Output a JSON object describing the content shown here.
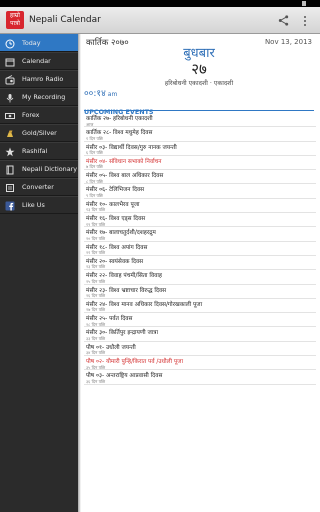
{
  "app": {
    "title": "Nepali Calendar",
    "logo_text_top": "हाम्रो",
    "logo_text_bottom": "पात्रो"
  },
  "drawer": {
    "items": [
      {
        "label": "Today",
        "icon": "calendar-today-icon",
        "active": true
      },
      {
        "label": "Calendar",
        "icon": "calendar-icon",
        "active": false
      },
      {
        "label": "Hamro Radio",
        "icon": "radio-icon",
        "active": false
      },
      {
        "label": "My Recording",
        "icon": "microphone-icon",
        "active": false
      },
      {
        "label": "Forex",
        "icon": "currency-icon",
        "active": false
      },
      {
        "label": "Gold/Silver",
        "icon": "gold-icon",
        "active": false
      },
      {
        "label": "Rashifal",
        "icon": "star-icon",
        "active": false
      },
      {
        "label": "Nepali Dictionary",
        "icon": "book-icon",
        "active": false
      },
      {
        "label": "Converter",
        "icon": "converter-icon",
        "active": false
      },
      {
        "label": "Like Us",
        "icon": "facebook-icon",
        "active": false
      }
    ]
  },
  "today": {
    "nepali_month": "कार्तिक २०७०",
    "english_date": "Nov 13, 2013",
    "weekday": "बुधबार",
    "day": "२७",
    "tithi": "हरिबोधनी एकादशी · एकादशी",
    "time": "००:१४",
    "ampm": "am"
  },
  "upcoming": {
    "header": "UPCOMING EVENTS",
    "events": [
      {
        "title": "कार्तिक २७- हरिबोधनी एकादशी",
        "sub": "आज",
        "holiday": false
      },
      {
        "title": "कार्तिक २८- विश्व मधुमेह दिवस",
        "sub": "१ दिन पछि",
        "holiday": false
      },
      {
        "title": "मंसीर ०३- विद्यार्थी दिवस/गुरु नानक जयन्ती",
        "sub": "६ दिन पछि",
        "holiday": false
      },
      {
        "title": "मंसीर ०४- संविधान सभाको निर्वाचन",
        "sub": "७ दिन पछि",
        "holiday": true
      },
      {
        "title": "मंसीर ०५- विश्व बाल अधिकार दिवस",
        "sub": "८ दिन पछि",
        "holiday": false
      },
      {
        "title": "मंसीर ०६- टेलिभिजन दिवस",
        "sub": "९ दिन पछि",
        "holiday": false
      },
      {
        "title": "मंसीर १०- कालभैरव पूजा",
        "sub": "१३ दिन पछि",
        "holiday": false
      },
      {
        "title": "मंसीर १६- विश्व एड्स दिवस",
        "sub": "१९ दिन पछि",
        "holiday": false
      },
      {
        "title": "मंसीर १७- बालाचतुर्दशी/दशहरद्रुम",
        "sub": "२० दिन पछि",
        "holiday": false
      },
      {
        "title": "मंसीर १८- विश्व अपांग दिवस",
        "sub": "२१ दिन पछि",
        "holiday": false
      },
      {
        "title": "मंसीर २०- स्वयंसेवक दिवस",
        "sub": "२३ दिन पछि",
        "holiday": false
      },
      {
        "title": "मंसीर २२- विवाह पंचमी/सिता विवाह",
        "sub": "२५ दिन पछि",
        "holiday": false
      },
      {
        "title": "मंसीर २३- विश्व भ्रष्टाचार विरुद्ध दिवस",
        "sub": "२६ दिन पछि",
        "holiday": false
      },
      {
        "title": "मंसीर २४- विश्व मानव अधिकार दिवस/गोरखकाली पूजा",
        "sub": "२७ दिन पछि",
        "holiday": false
      },
      {
        "title": "मंसीर २५- पर्वत दिवस",
        "sub": "२८ दिन पछि",
        "holiday": false
      },
      {
        "title": "मंसीर ३०- किर्तिपुर इन्द्रायणी जात्रा",
        "sub": "३३ दिन पछि",
        "holiday": false
      },
      {
        "title": "पौष ०१- उधौली जयन्ती",
        "sub": "३४ दिन पछि",
        "holiday": false
      },
      {
        "title": "पौष ०२- यौमारी पुन्हि/किरात पर्व /उधौली पूजा",
        "sub": "३५ दिन पछि",
        "holiday": true
      },
      {
        "title": "पौष ०३- अन्तराष्ट्रिय आप्रवासी दिवस",
        "sub": "३६ दिन पछि",
        "holiday": false
      }
    ]
  },
  "colors": {
    "accent": "#2f78c4",
    "holiday": "#d32f2f",
    "drawer_bg": "#2b2b2b"
  }
}
